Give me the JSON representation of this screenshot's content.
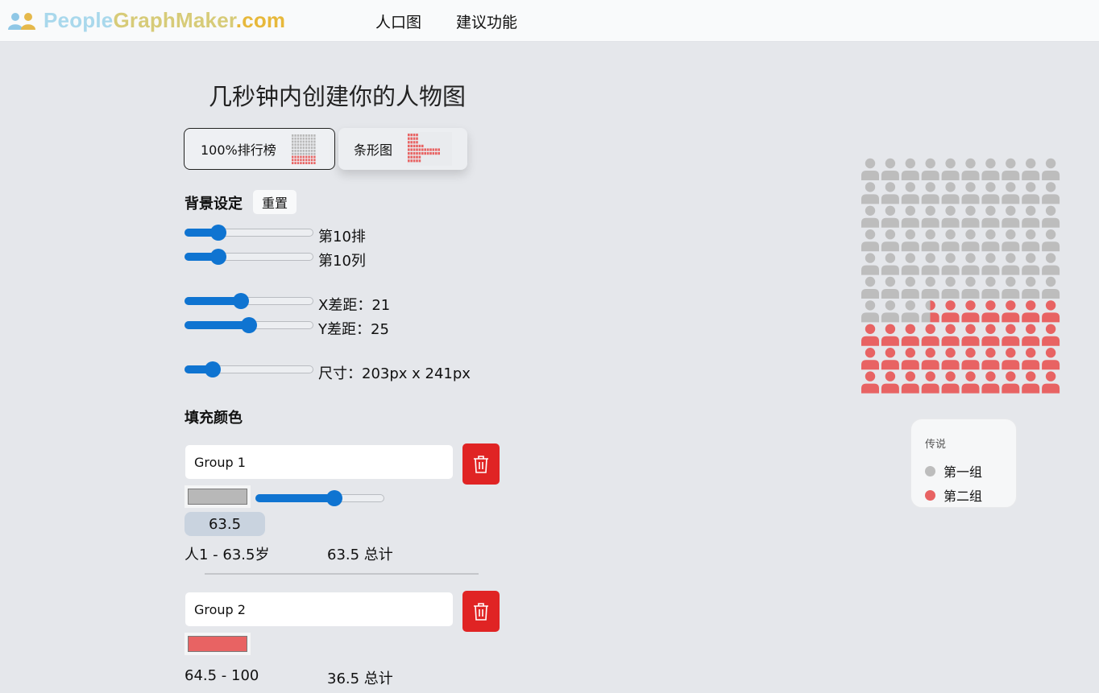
{
  "brand": {
    "part1": "People",
    "part2": "Graph",
    "part3": "Maker",
    "part4": ".com"
  },
  "nav": {
    "population": "人口图",
    "suggest": "建议功能"
  },
  "headline": "几秒钟内创建你的人物图",
  "chart_types": {
    "ranking": "100%排行榜",
    "bar": "条形图"
  },
  "background": {
    "title": "背景设定",
    "reset": "重置",
    "rows_label": "第10排",
    "cols_label": "第10列",
    "x_gap_label": "X差距：21",
    "y_gap_label": "Y差距：25",
    "size_label": "尺寸：203px x 241px",
    "rows": 10,
    "cols": 10,
    "sliders": {
      "rows": 0.23,
      "cols": 0.23,
      "x_gap": 0.43,
      "y_gap": 0.5,
      "size": 0.18
    }
  },
  "fill": {
    "title": "填充颜色",
    "groups": [
      {
        "name": "Group 1",
        "color": "#b8b8b8",
        "slider": 0.63,
        "value": "63.5",
        "range": "人1 - 63.5岁",
        "total": "63.5 总计"
      },
      {
        "name": "Group 2",
        "color": "#e86363",
        "range": "64.5 - 100",
        "total": "36.5 总计"
      }
    ]
  },
  "people_graph": {
    "total": 100,
    "group1_count": 63.5,
    "group1_color": "#bdbdbd",
    "group2_color": "#e86363"
  },
  "legend": {
    "title": "传说",
    "items": [
      {
        "label": "第一组",
        "color": "#bdbdbd"
      },
      {
        "label": "第二组",
        "color": "#e86363"
      }
    ]
  },
  "icons": {
    "logo": "people-icon",
    "delete": "trash-icon"
  }
}
